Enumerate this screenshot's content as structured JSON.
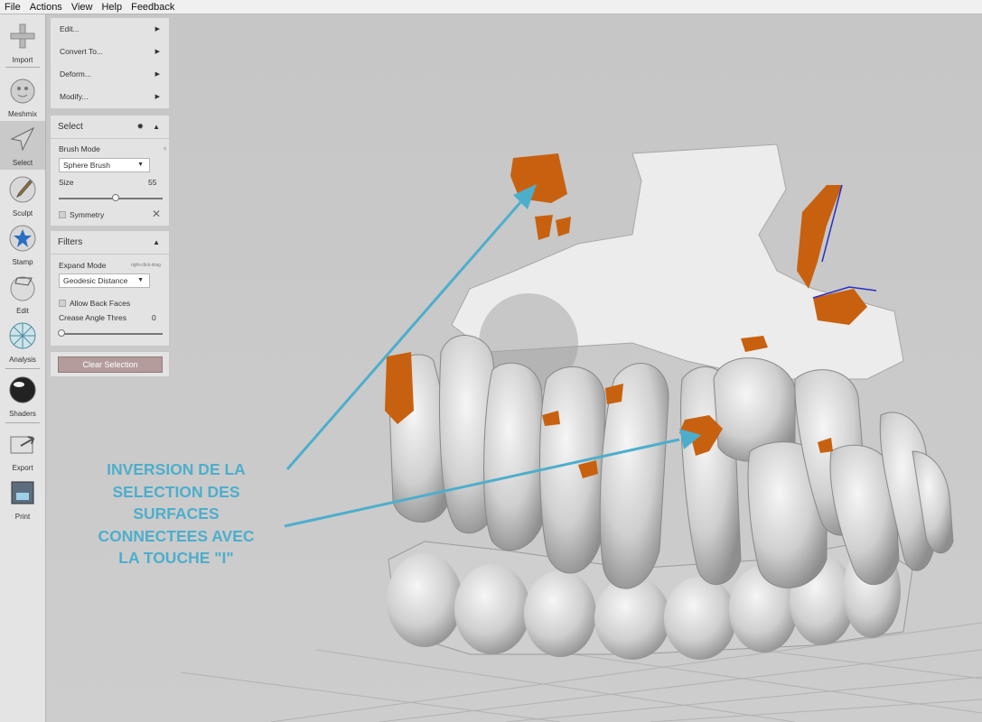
{
  "menubar": {
    "items": [
      "File",
      "Actions",
      "View",
      "Help",
      "Feedback"
    ]
  },
  "tools": [
    {
      "label": "Import",
      "icon": "plus-icon"
    },
    {
      "label": "Meshmix",
      "icon": "bunny-head-icon"
    },
    {
      "label": "Select",
      "icon": "arrow-cursor-icon"
    },
    {
      "label": "Sculpt",
      "icon": "brush-icon"
    },
    {
      "label": "Stamp",
      "icon": "stamp-icon"
    },
    {
      "label": "Edit",
      "icon": "sphere-edit-icon"
    },
    {
      "label": "Analysis",
      "icon": "mesh-sphere-icon"
    },
    {
      "label": "Shaders",
      "icon": "shader-ball-icon"
    },
    {
      "label": "Export",
      "icon": "export-icon"
    },
    {
      "label": "Print",
      "icon": "printer-icon"
    }
  ],
  "edit_menu": {
    "items": [
      "Edit...",
      "Convert To...",
      "Deform...",
      "Modify..."
    ],
    "arrow": "▶"
  },
  "select_panel": {
    "title": "Select",
    "brush_mode_label": "Brush Mode",
    "brush_mode_hint": "q",
    "brush_mode_value": "Sphere Brush",
    "size_label": "Size",
    "size_value": "55",
    "size_fraction": 0.55,
    "symmetry_label": "Symmetry"
  },
  "filters_panel": {
    "title": "Filters",
    "expand_mode_label": "Expand Mode",
    "expand_mode_hint": "right-click-drag",
    "expand_mode_value": "Geodesic Distance",
    "allow_back_faces_label": "Allow Back Faces",
    "crease_label": "Crease Angle Thres",
    "crease_value": "0"
  },
  "clear_selection_label": "Clear Selection",
  "annotation": {
    "lines": [
      "INVERSION DE LA",
      "SELECTION DES",
      "SURFACES",
      "CONNECTEES AVEC",
      "LA TOUCHE \"I\""
    ],
    "color": "#4daecc"
  },
  "colors": {
    "selection": "#c8610f",
    "mesh": "#dcdcdc",
    "viewport_bg": "#c8c8c8",
    "button": "#b49c9c"
  }
}
